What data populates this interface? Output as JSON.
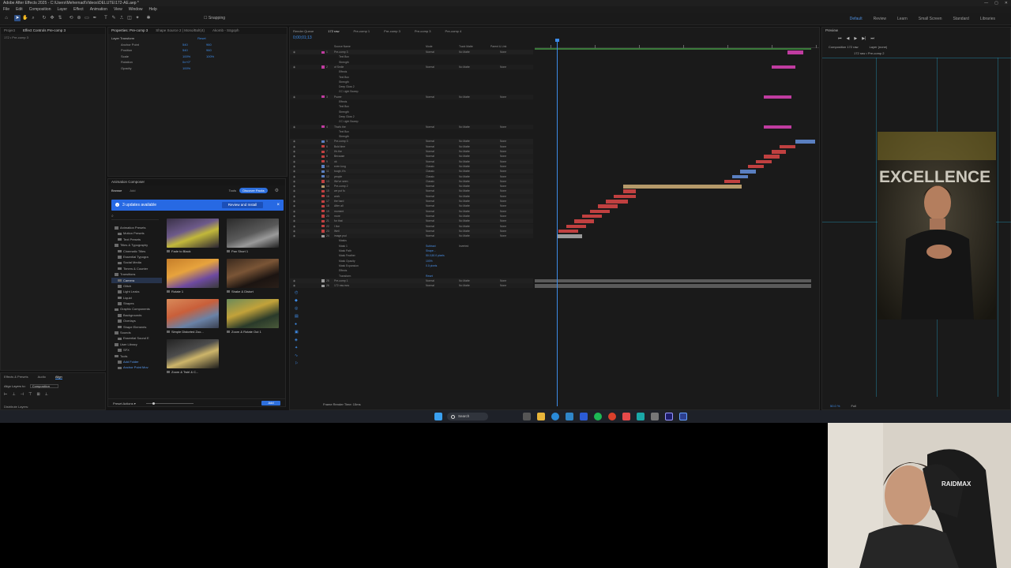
{
  "window": {
    "title": "Adobe After Effects 2025 - C:\\Users\\Mehernad\\Videos\\DELUTE\\172-AE.aep *",
    "controls": [
      "—",
      "▢",
      "✕"
    ]
  },
  "menu": [
    "File",
    "Edit",
    "Composition",
    "Layer",
    "Effect",
    "Animation",
    "View",
    "Window",
    "Help"
  ],
  "toolbar": {
    "snapping_label": "Snapping",
    "workspaces": [
      {
        "label": "Default",
        "active": true
      },
      {
        "label": "Review",
        "active": false
      },
      {
        "label": "Learn",
        "active": false
      },
      {
        "label": "Small Screen",
        "active": false
      },
      {
        "label": "Standard",
        "active": false
      },
      {
        "label": "Libraries",
        "active": false
      }
    ]
  },
  "project_panel": {
    "tabs": [
      "Project",
      "Effect Controls Pre-comp 3"
    ],
    "subtitle": "172 • Pre-comp 3"
  },
  "properties_panel": {
    "tabs": [
      "Properties: Pre-comp 3",
      "Shape Source 2 | Mono/Bolt(4)",
      "Akomb - Sögoph"
    ],
    "section": "Layer Transform",
    "reset_label": "Reset",
    "rows": [
      {
        "label": "Anchor Point",
        "value": "540",
        "value2": "960"
      },
      {
        "label": "Position",
        "value": "540",
        "value2": "960"
      },
      {
        "label": "Scale",
        "value": "100%",
        "value2": "100%"
      },
      {
        "label": "Rotation",
        "value": "0x+0°",
        "value2": ""
      },
      {
        "label": "Opacity",
        "value": "100%",
        "value2": ""
      }
    ]
  },
  "animation_composer": {
    "title": "Animation Composer",
    "tabs": [
      "Browse",
      "Add"
    ],
    "tools_label": "Tools",
    "discover_label": "Discover Packs",
    "banner_text": "3 updates available",
    "banner_button": "Review and Install",
    "tree": [
      {
        "label": "Animation Presets",
        "level": 1
      },
      {
        "label": "Motion Presets",
        "level": 2
      },
      {
        "label": "Text Presets",
        "level": 2
      },
      {
        "label": "Titles & Typography",
        "level": 1
      },
      {
        "label": "Cinematic Titles",
        "level": 2
      },
      {
        "label": "Essential Typogra",
        "level": 2
      },
      {
        "label": "Social Media",
        "level": 2
      },
      {
        "label": "Timers & Counter",
        "level": 2
      },
      {
        "label": "Transitions",
        "level": 1
      },
      {
        "label": "Camera",
        "level": 2,
        "selected": true
      },
      {
        "label": "Glitch",
        "level": 2
      },
      {
        "label": "Light Leaks",
        "level": 2
      },
      {
        "label": "Liquid",
        "level": 2
      },
      {
        "label": "Shapes",
        "level": 2
      },
      {
        "label": "Graphic Components",
        "level": 1
      },
      {
        "label": "Backgrounds",
        "level": 2
      },
      {
        "label": "Overlays",
        "level": 2
      },
      {
        "label": "Shape Elements",
        "level": 2
      },
      {
        "label": "Sounds",
        "level": 1
      },
      {
        "label": "Essential Sound E",
        "level": 2
      },
      {
        "label": "User Library",
        "level": 1
      },
      {
        "label": "SFX",
        "level": 2
      },
      {
        "label": "Tools",
        "level": 1
      },
      {
        "label": "Add Folder",
        "level": 2,
        "blue": true
      },
      {
        "label": "Anchor Point Mov",
        "level": 2,
        "blue": true
      }
    ],
    "presets": [
      {
        "label": "Fade to Black"
      },
      {
        "label": "Pan Short 1"
      },
      {
        "label": "Rotate 1"
      },
      {
        "label": "Shake & Distort"
      },
      {
        "label": "Simple Distorted Zoo..."
      },
      {
        "label": "Zoom & Rotate Out 1"
      },
      {
        "label": "Zoom & Twirl & C..."
      }
    ],
    "footer": {
      "preset_actions": "Preset Actions",
      "add_label": "Add"
    }
  },
  "effects_panel": {
    "tabs": [
      "Effects & Presets",
      "Audio",
      "Align"
    ],
    "align_layers_to": "Align Layers to:",
    "align_value": "Composition",
    "distribute_label": "Distribute Layers:"
  },
  "timeline": {
    "tabs": [
      "Render Queue",
      "172 raw",
      "Pre-comp 1",
      "Pre-comp 3",
      "Pre-comp 3",
      "Pre-comp 4"
    ],
    "active_tab": 1,
    "timecode": "0;00;01;13",
    "columns": {
      "name": "Source Name",
      "mode": "Mode",
      "track": "Track Matte",
      "parent": "Parent & Link"
    },
    "layers": [
      {
        "num": "1",
        "name": "Pre-comp 3",
        "mode": "Normal",
        "track": "No Matte",
        "parent": "None",
        "color": "#c03ca0",
        "type": "layer"
      },
      {
        "num": "",
        "name": "Text Box",
        "mode": "",
        "track": "",
        "parent": "",
        "color": "",
        "type": "prop"
      },
      {
        "num": "",
        "name": "Strength",
        "mode": "",
        "track": "",
        "parent": "",
        "color": "",
        "type": "prop"
      },
      {
        "num": "2",
        "name": "of Smile",
        "mode": "Normal",
        "track": "No Matte",
        "parent": "None",
        "color": "#c03ca0",
        "type": "layer"
      },
      {
        "num": "",
        "name": "Effects",
        "mode": "",
        "track": "",
        "parent": "",
        "color": "",
        "type": "prop"
      },
      {
        "num": "",
        "name": "Text Box",
        "mode": "",
        "track": "",
        "parent": "",
        "color": "",
        "type": "prop"
      },
      {
        "num": "",
        "name": "Strength",
        "mode": "",
        "track": "",
        "parent": "",
        "color": "",
        "type": "prop"
      },
      {
        "num": "",
        "name": "Deep Glow 2",
        "mode": "",
        "track": "",
        "parent": "",
        "color": "",
        "type": "prop"
      },
      {
        "num": "",
        "name": "CC Light Sweep",
        "mode": "",
        "track": "",
        "parent": "",
        "color": "",
        "type": "prop"
      },
      {
        "num": "3",
        "name": "Power",
        "mode": "Normal",
        "track": "No Matte",
        "parent": "None",
        "color": "#c03ca0",
        "type": "layer"
      },
      {
        "num": "",
        "name": "Effects",
        "mode": "",
        "track": "",
        "parent": "",
        "color": "",
        "type": "prop"
      },
      {
        "num": "",
        "name": "Text Box",
        "mode": "",
        "track": "",
        "parent": "",
        "color": "",
        "type": "prop"
      },
      {
        "num": "",
        "name": "Strength",
        "mode": "",
        "track": "",
        "parent": "",
        "color": "",
        "type": "prop"
      },
      {
        "num": "",
        "name": "Deep Glow 2",
        "mode": "",
        "track": "",
        "parent": "",
        "color": "",
        "type": "prop"
      },
      {
        "num": "",
        "name": "CC Light Sweep",
        "mode": "",
        "track": "",
        "parent": "",
        "color": "",
        "type": "prop"
      },
      {
        "num": "4",
        "name": "That's the",
        "mode": "Normal",
        "track": "No Matte",
        "parent": "None",
        "color": "#c03ca0",
        "type": "layer"
      },
      {
        "num": "",
        "name": "Text Box",
        "mode": "",
        "track": "",
        "parent": "",
        "color": "",
        "type": "prop"
      },
      {
        "num": "",
        "name": "Strength",
        "mode": "",
        "track": "",
        "parent": "",
        "color": "",
        "type": "prop"
      },
      {
        "num": "5",
        "name": "Pre-comp 3",
        "mode": "Normal",
        "track": "No Matte",
        "parent": "None",
        "color": "#5a7fc0",
        "type": "layer"
      },
      {
        "num": "6",
        "name": "Bold time",
        "mode": "Normal",
        "track": "No Matte",
        "parent": "None",
        "color": "#c04040",
        "type": "layer"
      },
      {
        "num": "7",
        "name": "It's the",
        "mode": "Normal",
        "track": "No Matte",
        "parent": "None",
        "color": "#c04040",
        "type": "layer"
      },
      {
        "num": "8",
        "name": "Because",
        "mode": "Normal",
        "track": "No Matte",
        "parent": "None",
        "color": "#c04040",
        "type": "layer"
      },
      {
        "num": "9",
        "name": "ok",
        "mode": "Normal",
        "track": "No Matte",
        "parent": "None",
        "color": "#c04040",
        "type": "layer"
      },
      {
        "num": "10",
        "name": "even long",
        "mode": "Classic",
        "track": "No Matte",
        "parent": "None",
        "color": "#5a7fc0",
        "type": "layer"
      },
      {
        "num": "11",
        "name": "tough, it's",
        "mode": "Classic",
        "track": "No Matte",
        "parent": "None",
        "color": "#5a7fc0",
        "type": "layer"
      },
      {
        "num": "12",
        "name": "people",
        "mode": "Classic",
        "track": "No Matte",
        "parent": "None",
        "color": "#5a7fc0",
        "type": "layer"
      },
      {
        "num": "13",
        "name": "We've seen",
        "mode": "Classic",
        "track": "No Matte",
        "parent": "None",
        "color": "#c04040",
        "type": "layer"
      },
      {
        "num": "14",
        "name": "Pre-comp 2",
        "mode": "Normal",
        "track": "No Matte",
        "parent": "None",
        "color": "#b59a6a",
        "type": "layer"
      },
      {
        "num": "15",
        "name": "we put fo",
        "mode": "Normal",
        "track": "No Matte",
        "parent": "None",
        "color": "#c04040",
        "type": "layer"
      },
      {
        "num": "16",
        "name": "work",
        "mode": "Normal",
        "track": "No Matte",
        "parent": "None",
        "color": "#c04040",
        "type": "layer"
      },
      {
        "num": "17",
        "name": "the hard",
        "mode": "Normal",
        "track": "No Matte",
        "parent": "None",
        "color": "#c04040",
        "type": "layer"
      },
      {
        "num": "18",
        "name": "After all",
        "mode": "Normal",
        "track": "No Matte",
        "parent": "None",
        "color": "#c04040",
        "type": "layer"
      },
      {
        "num": "19",
        "name": "moment",
        "mode": "Normal",
        "track": "No Matte",
        "parent": "None",
        "color": "#c04040",
        "type": "layer"
      },
      {
        "num": "20",
        "name": "more",
        "mode": "Normal",
        "track": "No Matte",
        "parent": "None",
        "color": "#c04040",
        "type": "layer"
      },
      {
        "num": "21",
        "name": "for that",
        "mode": "Normal",
        "track": "No Matte",
        "parent": "None",
        "color": "#c04040",
        "type": "layer"
      },
      {
        "num": "22",
        "name": "I live",
        "mode": "Normal",
        "track": "No Matte",
        "parent": "None",
        "color": "#c04040",
        "type": "layer"
      },
      {
        "num": "23",
        "name": "Well",
        "mode": "Normal",
        "track": "No Matte",
        "parent": "None",
        "color": "#c04040",
        "type": "layer"
      },
      {
        "num": "24",
        "name": "image.psd",
        "mode": "Normal",
        "track": "No Matte",
        "parent": "None",
        "color": "#9a9a9a",
        "type": "layer"
      },
      {
        "num": "",
        "name": "Masks",
        "mode": "",
        "track": "",
        "parent": "",
        "color": "",
        "type": "prop"
      },
      {
        "num": "",
        "name": "Mask 1",
        "mode": "Subtract",
        "track": "Inverted",
        "parent": "",
        "color": "",
        "type": "prop"
      },
      {
        "num": "",
        "name": "Mask Path",
        "mode": "Shape...",
        "track": "",
        "parent": "",
        "color": "",
        "type": "prop"
      },
      {
        "num": "",
        "name": "Mask Feather",
        "mode": "50.0,50.0 pixels",
        "track": "",
        "parent": "",
        "color": "",
        "type": "prop"
      },
      {
        "num": "",
        "name": "Mask Opacity",
        "mode": "100%",
        "track": "",
        "parent": "",
        "color": "",
        "type": "prop"
      },
      {
        "num": "",
        "name": "Mask Expansion",
        "mode": "0.0 pixels",
        "track": "",
        "parent": "",
        "color": "",
        "type": "prop"
      },
      {
        "num": "",
        "name": "Effects",
        "mode": "",
        "track": "",
        "parent": "",
        "color": "",
        "type": "prop"
      },
      {
        "num": "",
        "name": "Transform",
        "mode": "Reset",
        "track": "",
        "parent": "",
        "color": "",
        "type": "prop"
      },
      {
        "num": "25",
        "name": "Pre-comp 1",
        "mode": "Normal",
        "track": "No Matte",
        "parent": "None",
        "color": "#9a9a9a",
        "type": "layer"
      },
      {
        "num": "26",
        "name": "172 raw.mov",
        "mode": "Normal",
        "track": "No Matte",
        "parent": "None",
        "color": "#9a9a9a",
        "type": "layer"
      }
    ],
    "frame_render_label": "Frame Render Time: 15ms"
  },
  "viewer": {
    "panel_title": "Preview",
    "tabs": [
      "Composition 172 raw",
      "Layer (none)"
    ],
    "breadcrumb": "172 raw  •  Pre-comp 2",
    "overlay_text": "EXCELLENCE",
    "footer": [
      "50.0 %",
      "Full"
    ]
  },
  "taskbar": {
    "search_label": "Search"
  },
  "webcam": {
    "hat_text": "RAIDMAX"
  }
}
